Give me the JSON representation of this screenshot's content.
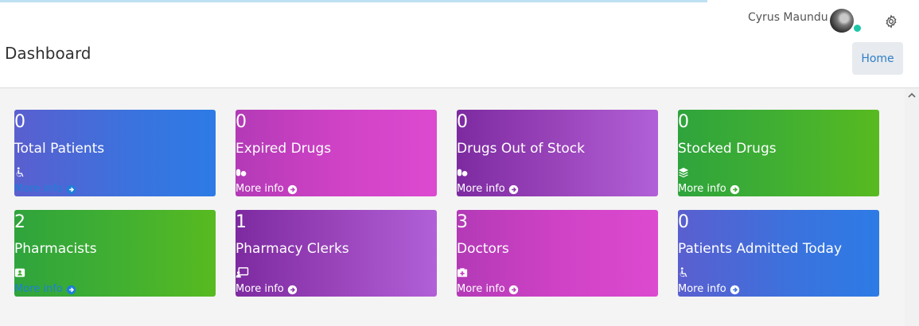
{
  "loading_bar": {
    "progress": 0.77,
    "color": "#bfe0f3"
  },
  "header": {
    "user_name": "Cyrus Maundu",
    "page_title": "Dashboard",
    "home_label": "Home",
    "settings_icon": "gear-icon",
    "status_color": "#1cc7a8"
  },
  "cards": [
    {
      "value": "0",
      "label": "Total Patients",
      "icon": "wheelchair-icon",
      "more": "More info"
    },
    {
      "value": "0",
      "label": "Expired Drugs",
      "icon": "pills-icon",
      "more": "More info"
    },
    {
      "value": "0",
      "label": "Drugs Out of Stock",
      "icon": "pills-icon",
      "more": "More info"
    },
    {
      "value": "0",
      "label": "Stocked Drugs",
      "icon": "layers-icon",
      "more": "More info"
    },
    {
      "value": "2",
      "label": "Pharmacists",
      "icon": "id-badge-icon",
      "more": "More info"
    },
    {
      "value": "1",
      "label": "Pharmacy Clerks",
      "icon": "teacher-icon",
      "more": "More info"
    },
    {
      "value": "3",
      "label": "Doctors",
      "icon": "first-aid-icon",
      "more": "More info"
    },
    {
      "value": "0",
      "label": "Patients Admitted Today",
      "icon": "wheelchair-icon",
      "more": "More info"
    }
  ]
}
